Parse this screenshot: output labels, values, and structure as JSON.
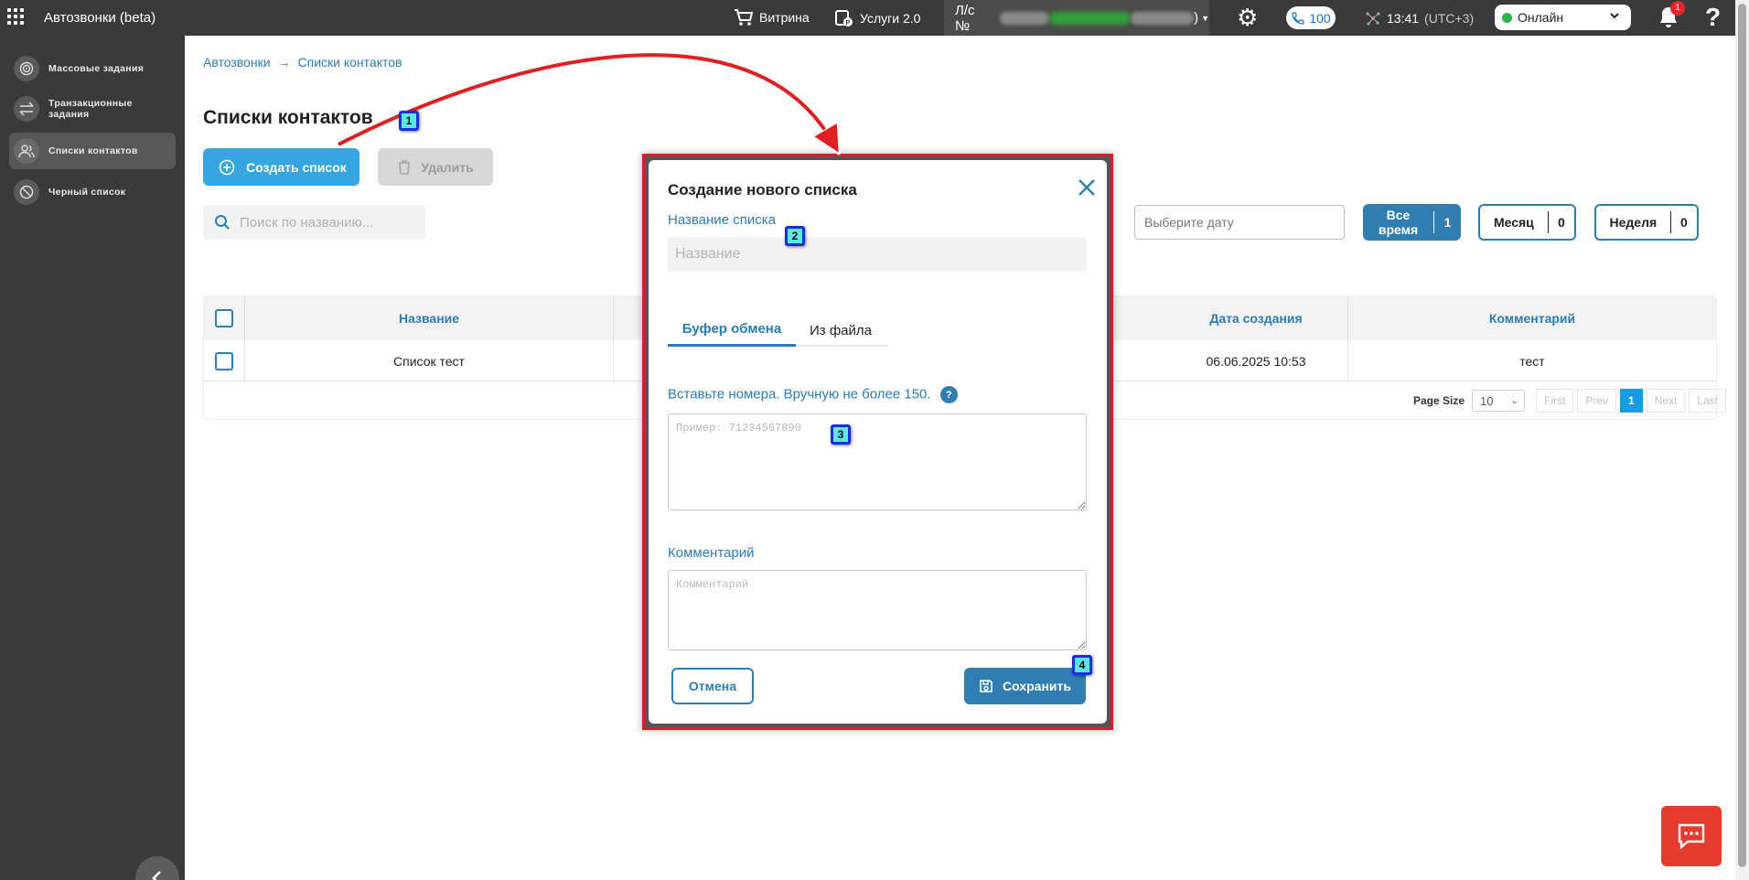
{
  "topbar": {
    "app_title": "Автозвонки (beta)",
    "vitrina_label": "Витрина",
    "services_label": "Услуги 2.0",
    "account_prefix": "Л/с №",
    "account_suffix": ")",
    "calls_count": "100",
    "time": "13:41",
    "timezone": "(UTC+3)",
    "status_value": "Онлайн",
    "notifications_count": "1",
    "help_label": "?"
  },
  "sidebar": {
    "items": [
      {
        "label": "Массовые задания",
        "icon": "target-icon"
      },
      {
        "label": "Транзакционные задания",
        "icon": "transfer-arrows-icon"
      },
      {
        "label": "Списки контактов",
        "icon": "contacts-icon",
        "active": true
      },
      {
        "label": "Черный список",
        "icon": "block-icon"
      }
    ]
  },
  "breadcrumb": {
    "root": "Автозвонки",
    "separator": "→",
    "current": "Списки контактов"
  },
  "page": {
    "title": "Списки контактов",
    "create_button": "Создать список",
    "delete_button": "Удалить",
    "search_placeholder": "Поиск по названию...",
    "date_placeholder": "Выберите дату"
  },
  "period_filters": [
    {
      "label": "Все время",
      "count": "1"
    },
    {
      "label": "Месяц",
      "count": "0"
    },
    {
      "label": "Неделя",
      "count": "0"
    }
  ],
  "table": {
    "columns": [
      "Название",
      "Дата создания",
      "Комментарий"
    ],
    "rows": [
      {
        "name": "Список тест",
        "created": "06.06.2025 10:53",
        "comment": "тест"
      }
    ]
  },
  "pagination": {
    "page_size_label": "Page Size",
    "page_size_value": "10",
    "first": "First",
    "prev": "Prev",
    "current": "1",
    "next": "Next",
    "last": "Last"
  },
  "modal": {
    "title": "Создание нового списка",
    "name_label": "Название списка",
    "name_placeholder": "Название",
    "tab_clipboard": "Буфер обмена",
    "tab_file": "Из файла",
    "numbers_label": "Вставьте номера. Вручную не более 150.",
    "numbers_help": "?",
    "numbers_placeholder": "Пример: 71234567890",
    "comment_label": "Комментарий",
    "comment_placeholder": "Комментарий",
    "cancel_button": "Отмена",
    "save_button": "Сохранить"
  },
  "annotations": [
    "1",
    "2",
    "3",
    "4"
  ],
  "colors": {
    "topbar": "#3a3a3a",
    "primary": "#2f7db1",
    "create_button": "#36a6e0",
    "highlight_frame": "#d4202a",
    "marker_fill": "#5de6e8",
    "chat_button": "#e63a2e"
  }
}
